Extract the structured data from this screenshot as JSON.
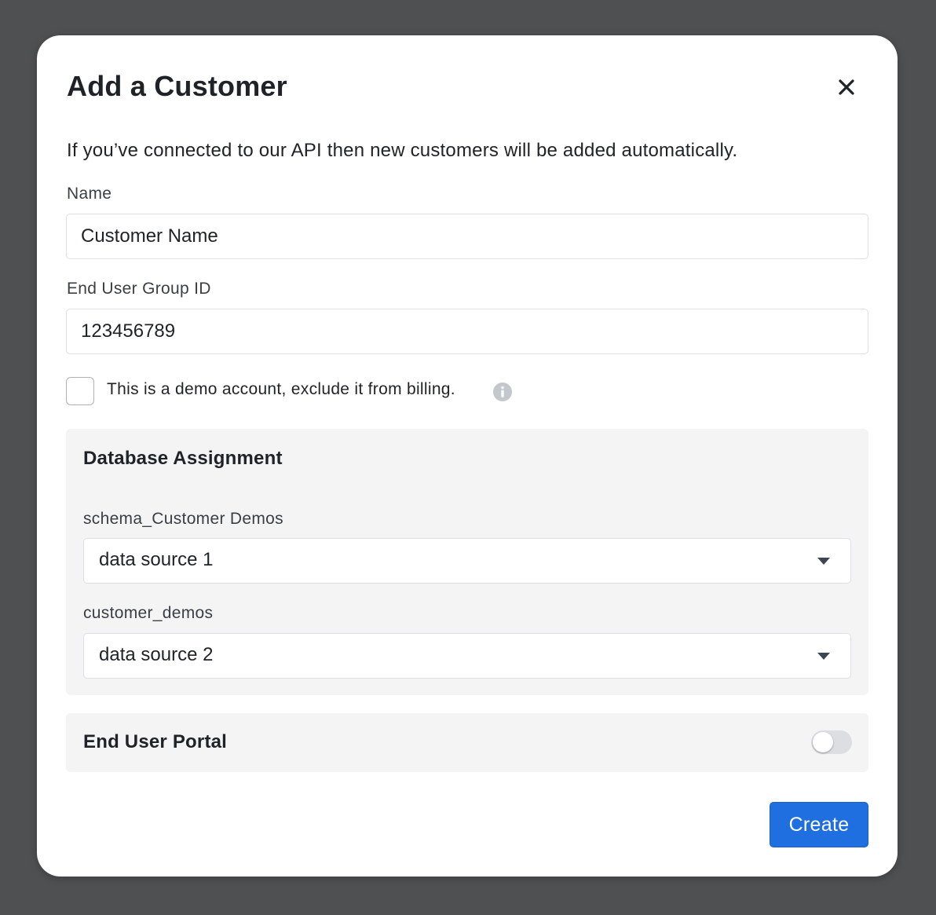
{
  "modal": {
    "title": "Add a Customer",
    "intro": "If you’ve connected to our API then new customers will be added automatically."
  },
  "form": {
    "name_label": "Name",
    "name_value": "Customer Name",
    "group_label": "End User Group ID",
    "group_value": "123456789",
    "demo_checkbox_label": "This is a demo account, exclude it from billing.",
    "demo_checked": false
  },
  "database_assignment": {
    "title": "Database Assignment",
    "fields": [
      {
        "label": "schema_Customer Demos",
        "value": "data source 1"
      },
      {
        "label": "customer_demos",
        "value": "data source 2"
      }
    ]
  },
  "portal": {
    "title": "End User Portal",
    "enabled": false
  },
  "actions": {
    "create_label": "Create"
  },
  "colors": {
    "backdrop": "#4f5051",
    "primary": "#1f6fe0",
    "panel_bg": "#f4f4f5"
  },
  "icons": {
    "close": "close-icon",
    "info": "info-icon",
    "dropdown": "chevron-down-icon"
  }
}
